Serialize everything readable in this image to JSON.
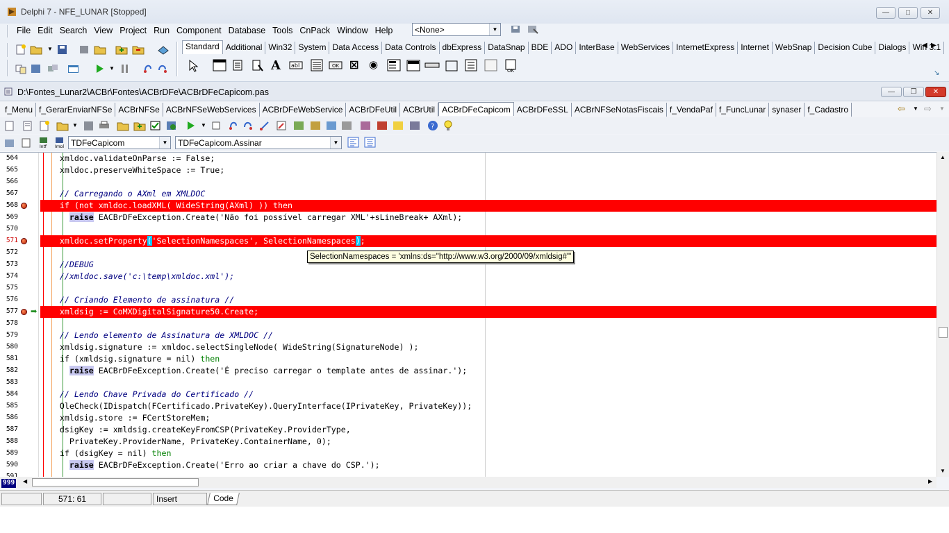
{
  "app": {
    "title": "Delphi 7 - NFE_LUNAR [Stopped]",
    "menu": [
      "File",
      "Edit",
      "Search",
      "View",
      "Project",
      "Run",
      "Component",
      "Database",
      "Tools",
      "CnPack",
      "Window",
      "Help"
    ],
    "desktop_combo": "<None>",
    "palette_tabs": [
      "Standard",
      "Additional",
      "Win32",
      "System",
      "Data Access",
      "Data Controls",
      "dbExpress",
      "DataSnap",
      "BDE",
      "ADO",
      "InterBase",
      "WebServices",
      "InternetExpress",
      "Internet",
      "WebSnap",
      "Decision Cube",
      "Dialogs",
      "Win 3.1"
    ],
    "palette_active": "Standard"
  },
  "editor": {
    "file_path": "D:\\Fontes_Lunar2\\ACBr\\Fontes\\ACBrDFe\\ACBrDFeCapicom.pas",
    "file_tabs": [
      "f_Menu",
      "f_GerarEnviarNFSe",
      "ACBrNFSe",
      "ACBrNFSeWebServices",
      "ACBrDFeWebService",
      "ACBrDFeUtil",
      "ACBrUtil",
      "ACBrDFeCapicom",
      "ACBrDFeSSL",
      "ACBrNFSeNotasFiscais",
      "f_VendaPaf",
      "f_FuncLunar",
      "synaser",
      "f_Cadastro"
    ],
    "active_tab": "ACBrDFeCapicom",
    "class_combo": "TDFeCapicom",
    "method_combo": "TDFeCapicom.Assinar",
    "tooltip": "SelectionNamespaces = 'xmlns:ds=\"http://www.w3.org/2000/09/xmldsig#\"'",
    "line_numbers": [
      "564",
      "565",
      "566",
      "567",
      "568",
      "569",
      "570",
      "571",
      "572",
      "573",
      "574",
      "575",
      "576",
      "577",
      "578",
      "579",
      "580",
      "581",
      "582",
      "583",
      "584",
      "585",
      "586",
      "587",
      "588",
      "589",
      "590",
      "591"
    ],
    "breakpoint_lines": [
      "568",
      "571",
      "577"
    ],
    "code": [
      "    xmldoc.validateOnParse := False;",
      "    xmldoc.preserveWhiteSpace := True;",
      "",
      "    // Carregando o AXml em XMLDOC",
      "    if (not xmldoc.loadXML( WideString(AXml) )) then",
      "      raise EACBrDFeException.Create('Não foi possível carregar XML'+sLineBreak+ AXml);",
      "",
      "    xmldoc.setProperty('SelectionNamespaces', SelectionNamespaces);",
      "",
      "    //DEBUG",
      "    //xmldoc.save('c:\\temp\\xmldoc.xml');",
      "",
      "    // Criando Elemento de assinatura //",
      "    xmldsig := CoMXDigitalSignature50.Create;",
      "",
      "    // Lendo elemento de Assinatura de XMLDOC //",
      "    xmldsig.signature := xmldoc.selectSingleNode( WideString(SignatureNode) );",
      "    if (xmldsig.signature = nil) then",
      "      raise EACBrDFeException.Create('É preciso carregar o template antes de assinar.');",
      "",
      "    // Lendo Chave Privada do Certificado //",
      "    OleCheck(IDispatch(FCertificado.PrivateKey).QueryInterface(IPrivateKey, PrivateKey));",
      "    xmldsig.store := FCertStoreMem;",
      "    dsigKey := xmldsig.createKeyFromCSP(PrivateKey.ProviderType,",
      "      PrivateKey.ProviderName, PrivateKey.ContainerName, 0);",
      "    if (dsigKey = nil) then",
      "      raise EACBrDFeException.Create('Erro ao criar a chave do CSP.');",
      ""
    ]
  },
  "status": {
    "cursor_pos": "571:  61",
    "mode": "Insert",
    "view_tab": "Code",
    "gutter_badge": "999"
  }
}
